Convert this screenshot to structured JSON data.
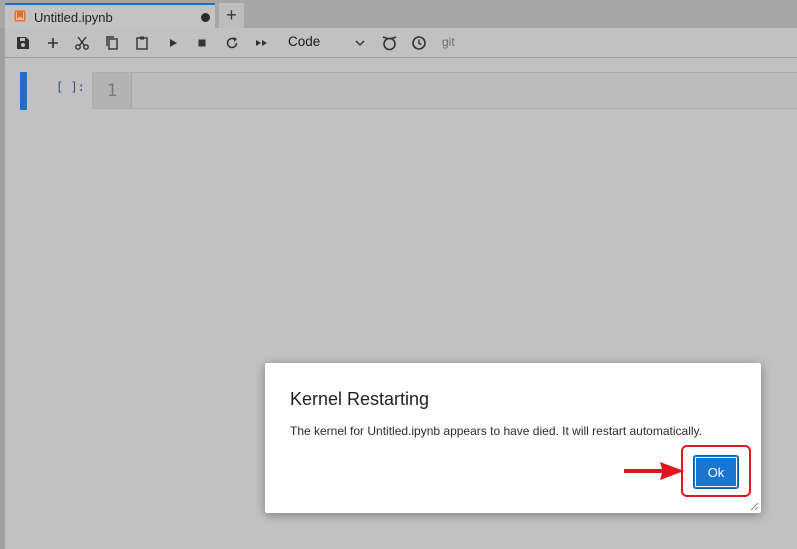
{
  "tab": {
    "title": "Untitled.ipynb",
    "new_tab_label": "+"
  },
  "toolbar": {
    "icons": [
      "save-icon",
      "add-cell-icon",
      "cut-icon",
      "copy-icon",
      "paste-icon",
      "run-icon",
      "stop-icon",
      "restart-icon",
      "fast-forward-icon",
      "kernel-icon",
      "clock-icon"
    ],
    "cell_type": "Code",
    "git_label": "git"
  },
  "cell": {
    "prompt": "[ ]:",
    "line_number": "1"
  },
  "dialog": {
    "title": "Kernel Restarting",
    "message": "The kernel for Untitled.ipynb appears to have died. It will restart automatically.",
    "ok_label": "Ok"
  },
  "colors": {
    "accent": "#1e6fc9",
    "ok_button": "#1976d2",
    "highlight": "#e3141c"
  }
}
